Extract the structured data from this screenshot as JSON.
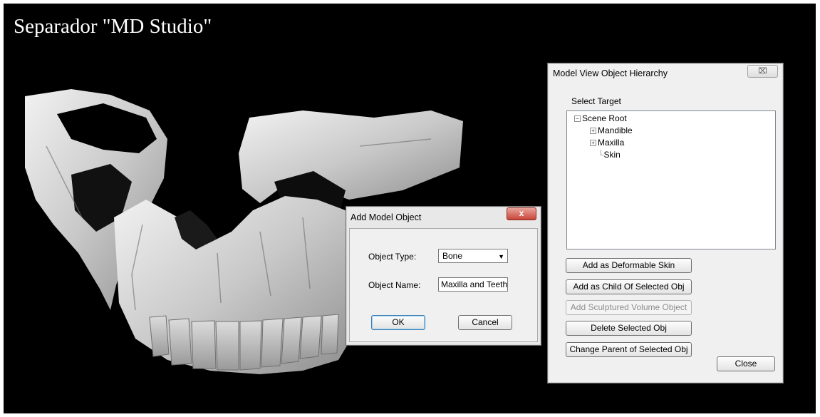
{
  "slide": {
    "title": "Separador \"MD Studio\""
  },
  "hierarchy_dialog": {
    "title": "Model View Object Hierarchy",
    "close_glyph": "⌧",
    "select_target_label": "Select Target",
    "tree": {
      "root": {
        "label": "Scene Root",
        "expander": "−"
      },
      "children": [
        {
          "label": "Mandible",
          "expander": "+"
        },
        {
          "label": "Maxilla",
          "expander": "+"
        },
        {
          "label": "Skin",
          "expander": ""
        }
      ]
    },
    "buttons": {
      "add_deformable_skin": "Add as Deformable Skin",
      "add_child": "Add as Child Of Selected Obj",
      "add_sculptured": "Add Sculptured Volume Object",
      "delete_selected": "Delete Selected Obj",
      "change_parent": "Change Parent of Selected Obj",
      "close": "Close"
    }
  },
  "add_object_dialog": {
    "title": "Add Model Object",
    "close_glyph": "x",
    "object_type_label": "Object Type:",
    "object_type_value": "Bone",
    "object_name_label": "Object Name:",
    "object_name_value": "Maxilla and Teeth",
    "ok_label": "OK",
    "cancel_label": "Cancel"
  },
  "colors": {
    "slide_background": "#000000",
    "dialog_background": "#f0f0f0",
    "close_button_red": "#c9463a"
  }
}
